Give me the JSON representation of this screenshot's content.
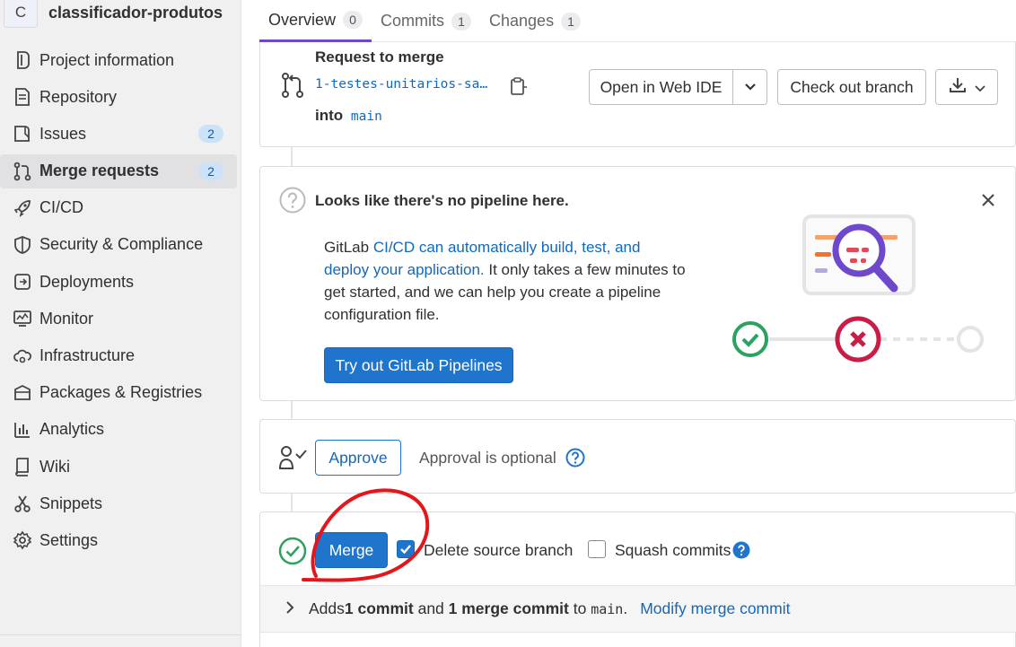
{
  "project": {
    "avatar_letter": "C",
    "name": "classificador-produtos"
  },
  "sidebar": {
    "items": [
      {
        "label": "Project information",
        "icon": "project-icon"
      },
      {
        "label": "Repository",
        "icon": "doc-icon"
      },
      {
        "label": "Issues",
        "icon": "issues-icon",
        "badge": "2"
      },
      {
        "label": "Merge requests",
        "icon": "merge-request-icon",
        "badge": "2",
        "active": true
      },
      {
        "label": "CI/CD",
        "icon": "rocket-icon"
      },
      {
        "label": "Security & Compliance",
        "icon": "shield-icon"
      },
      {
        "label": "Deployments",
        "icon": "deployments-icon"
      },
      {
        "label": "Monitor",
        "icon": "monitor-icon"
      },
      {
        "label": "Infrastructure",
        "icon": "cloud-gear-icon"
      },
      {
        "label": "Packages & Registries",
        "icon": "package-icon"
      },
      {
        "label": "Analytics",
        "icon": "chart-icon"
      },
      {
        "label": "Wiki",
        "icon": "book-icon"
      },
      {
        "label": "Snippets",
        "icon": "scissors-icon"
      },
      {
        "label": "Settings",
        "icon": "gear-icon"
      }
    ]
  },
  "tabs": [
    {
      "label": "Overview",
      "count": "0"
    },
    {
      "label": "Commits",
      "count": "1"
    },
    {
      "label": "Changes",
      "count": "1"
    }
  ],
  "request": {
    "title": "Request to merge",
    "source_branch": "1-testes-unitarios-sa…",
    "into_label": "into",
    "target_branch": "main",
    "open_ide_label": "Open in Web IDE",
    "checkout_label": "Check out branch"
  },
  "pipeline": {
    "title": "Looks like there's no pipeline here.",
    "body_prefix": "GitLab ",
    "body_link": "CI/CD can automatically build, test, and deploy your application.",
    "body_suffix": " It only takes a few minutes to get started, and we can help you create a pipeline configuration file.",
    "button_label": "Try out GitLab Pipelines"
  },
  "approval": {
    "button_label": "Approve",
    "status_text": "Approval is optional"
  },
  "merge": {
    "button_label": "Merge",
    "delete_source_label": "Delete source branch",
    "delete_source_checked": true,
    "squash_label": "Squash commits",
    "squash_checked": false,
    "info_prefix": "Adds ",
    "info_commit": "1 commit",
    "info_and": " and ",
    "info_merge_commit": "1 merge commit",
    "info_to": " to ",
    "info_branch": "main",
    "info_period": ".",
    "modify_label": "Modify merge commit"
  },
  "colors": {
    "accent": "#1f75cb",
    "tab_active": "#6e49cb",
    "success": "#2da160",
    "danger": "#dd2b0e",
    "annotation": "#e3171b"
  }
}
